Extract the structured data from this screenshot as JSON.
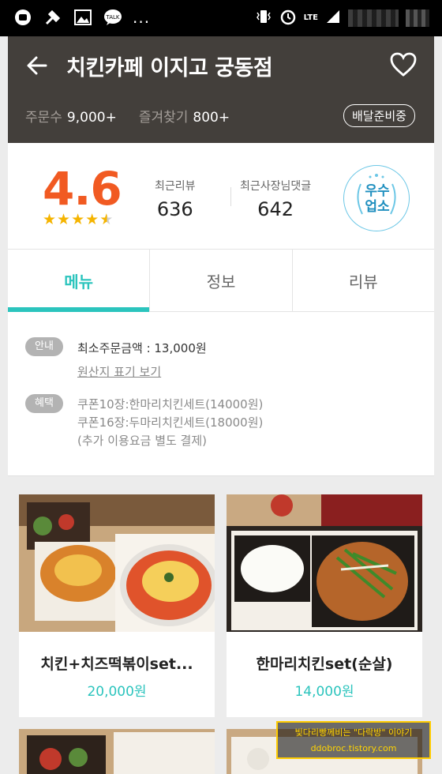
{
  "status_bar": {
    "left_icons": [
      "line-icon",
      "tool-icon",
      "image-icon",
      "talk-icon"
    ],
    "more": "...",
    "right_icons": [
      "vibrate-icon",
      "alarm-icon",
      "lte-icon",
      "signal-icon",
      "battery-icon"
    ],
    "lte_label": "LTE"
  },
  "header": {
    "title": "치킨카페 이지고 궁동점",
    "order_label": "주문수",
    "order_count": "9,000+",
    "fav_label": "즐겨찾기",
    "fav_count": "800+",
    "status": "배달준비중"
  },
  "rating": {
    "score": "4.6",
    "stars": 4.6,
    "recent_review_label": "최근리뷰",
    "recent_review_count": "636",
    "owner_reply_label": "최근사장님댓글",
    "owner_reply_count": "642",
    "badge_line1": "우수",
    "badge_line2": "업소"
  },
  "tabs": [
    {
      "label": "메뉴",
      "active": true
    },
    {
      "label": "정보",
      "active": false
    },
    {
      "label": "리뷰",
      "active": false
    }
  ],
  "info": {
    "notice_tag": "안내",
    "min_order": "최소주문금액 : 13,000원",
    "origin_link": "원산지 표기 보기",
    "benefit_tag": "혜택",
    "benefit_line1": "쿠폰10장:한마리치킨세트(14000원)",
    "benefit_line2": "쿠폰16장:두마리치킨세트(18000원)",
    "benefit_line3": "(추가 이용요금 별도 결제)"
  },
  "menu_items": [
    {
      "name": "치킨+치즈떡볶이set...",
      "price": "20,000원"
    },
    {
      "name": "한마리치킨set(순살)",
      "price": "14,000원"
    }
  ],
  "colors": {
    "accent": "#2bc4bd",
    "score": "#f15a22",
    "header_bg": "#433f3b",
    "star": "#f5b400"
  },
  "watermark": {
    "line1": "빛다리빵께비는 \"다락방\" 이야기",
    "line2": "ddobroc.tistory.com"
  }
}
